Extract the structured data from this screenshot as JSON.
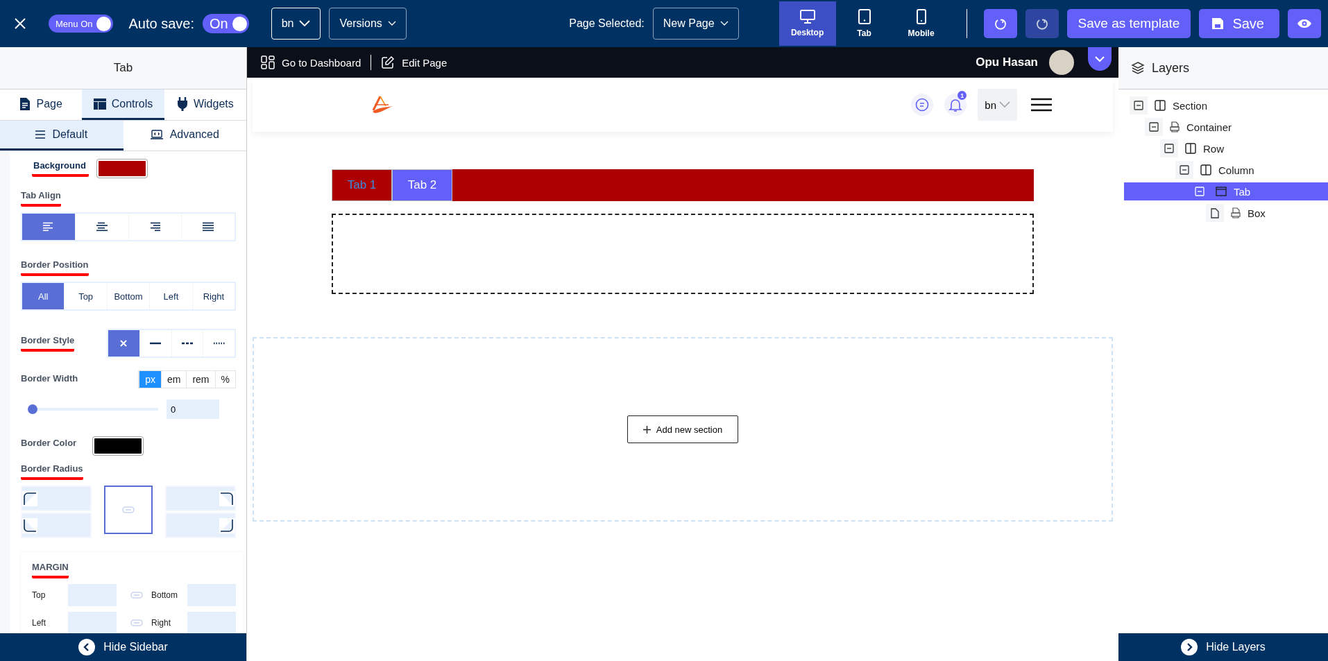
{
  "topbar": {
    "menu_toggle": {
      "label": "Menu On",
      "on": true
    },
    "autosave": {
      "label": "Auto save:",
      "toggle_label": "On",
      "on": true
    },
    "language": "bn",
    "versions": "Versions",
    "page_selected_label": "Page Selected:",
    "page_select": "New Page",
    "devices": [
      {
        "label": "Desktop",
        "kind": "desktop",
        "selected": true
      },
      {
        "label": "Tab",
        "kind": "tablet",
        "selected": false
      },
      {
        "label": "Mobile",
        "kind": "mobile",
        "selected": false
      }
    ],
    "undo": {
      "disabled": false
    },
    "redo": {
      "disabled": true
    },
    "save_template": "Save as template",
    "save": "Save"
  },
  "sidebar": {
    "title": "Tab",
    "tabs": [
      {
        "label": "Page",
        "kind": "page",
        "selected": false
      },
      {
        "label": "Controls",
        "kind": "controls",
        "selected": true
      },
      {
        "label": "Widgets",
        "kind": "widgets",
        "selected": false
      }
    ],
    "subtabs": [
      {
        "label": "Default",
        "kind": "default",
        "selected": true
      },
      {
        "label": "Advanced",
        "kind": "advanced",
        "selected": false
      }
    ],
    "background": {
      "label": "Background",
      "underlined": true,
      "color": "#aa0000"
    },
    "tab_align": {
      "label": "Tab Align",
      "underlined": true,
      "options": [
        {
          "kind": "left",
          "selected": true
        },
        {
          "kind": "center",
          "selected": false
        },
        {
          "kind": "right",
          "selected": false
        },
        {
          "kind": "justify",
          "selected": false
        }
      ]
    },
    "border_position": {
      "label": "Border Position",
      "underlined": true,
      "options": [
        {
          "label": "All",
          "selected": true
        },
        {
          "label": "Top",
          "selected": false
        },
        {
          "label": "Bottom",
          "selected": false
        },
        {
          "label": "Left",
          "selected": false
        },
        {
          "label": "Right",
          "selected": false
        }
      ]
    },
    "border_style": {
      "label": "Border Style",
      "underlined": true,
      "options": [
        {
          "kind": "none",
          "selected": true
        },
        {
          "kind": "solid",
          "selected": false
        },
        {
          "kind": "dashed",
          "selected": false
        },
        {
          "kind": "dotted",
          "selected": false
        }
      ]
    },
    "border_width": {
      "label": "Border Width",
      "underlined": false,
      "units": [
        {
          "label": "px",
          "selected": true
        },
        {
          "label": "em",
          "selected": false
        },
        {
          "label": "rem",
          "selected": false
        },
        {
          "label": "%",
          "selected": false
        }
      ],
      "level": 0,
      "value": "0"
    },
    "border_color": {
      "label": "Border Color",
      "underlined": false,
      "color": "#000000"
    },
    "border_radius": {
      "label": "Border Radius",
      "underlined": true
    },
    "margin": {
      "label": "MARGIN",
      "underlined": true,
      "fields": [
        "Top",
        "Bottom",
        "Left",
        "Right"
      ]
    },
    "hide_button": "Hide Sidebar"
  },
  "canvas": {
    "admin_bar": {
      "dashboard": "Go to Dashboard",
      "edit": "Edit Page",
      "user": "Opu Hasan"
    },
    "site_header": {
      "notifications": "1",
      "language": "bn"
    },
    "tab_widget": {
      "color": "#aa0000",
      "tabs": [
        {
          "label": "Tab 1",
          "selected": false
        },
        {
          "label": "Tab 2",
          "selected": true
        }
      ]
    },
    "add_section": "Add new section"
  },
  "layers": {
    "title": "Layers",
    "tree": [
      {
        "label": "Section",
        "kind": "section",
        "expanded": true,
        "selected": false,
        "children": [
          {
            "label": "Container",
            "kind": "container",
            "expanded": true,
            "selected": false,
            "children": [
              {
                "label": "Row",
                "kind": "row",
                "expanded": true,
                "selected": false,
                "children": [
                  {
                    "label": "Column",
                    "kind": "column",
                    "expanded": true,
                    "selected": false,
                    "children": [
                      {
                        "label": "Tab",
                        "kind": "tab",
                        "expanded": true,
                        "selected": true,
                        "children": [
                          {
                            "label": "Box",
                            "kind": "box",
                            "selected": false
                          }
                        ]
                      }
                    ]
                  }
                ]
              }
            ]
          }
        ]
      }
    ],
    "hide_button": "Hide Layers"
  }
}
